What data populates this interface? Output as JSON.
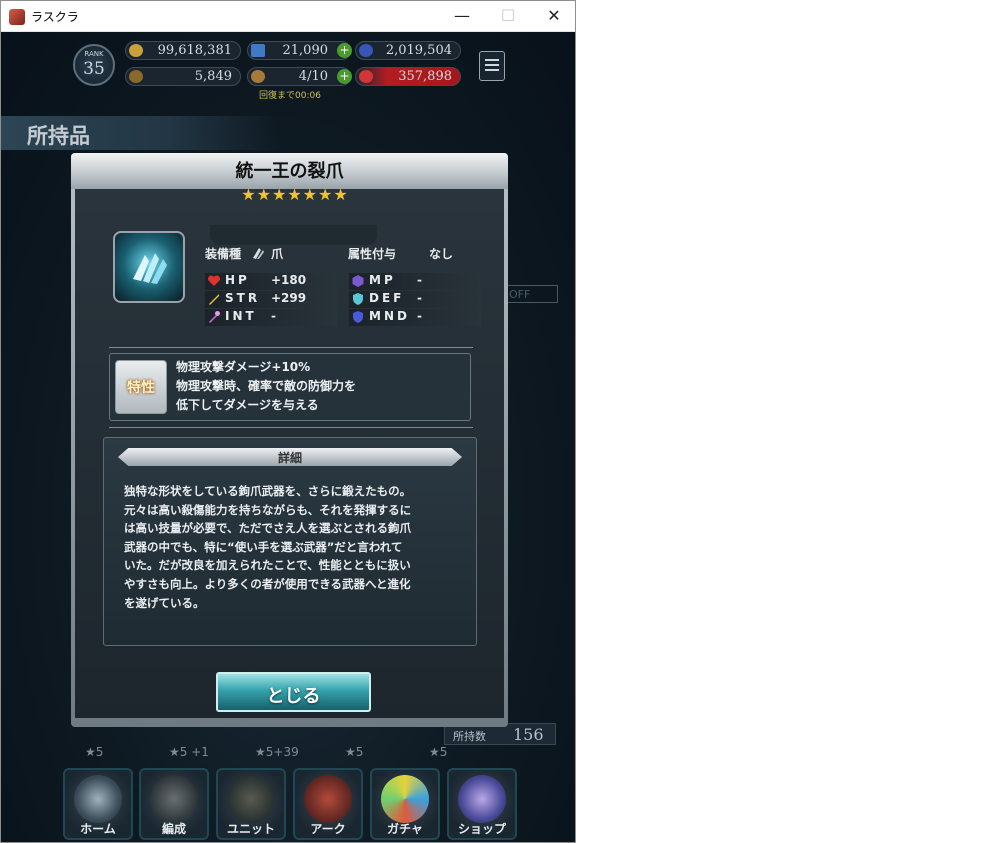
{
  "window": {
    "title": "ラスクラ",
    "min_glyph": "—",
    "max_glyph": "☐",
    "close_glyph": "✕"
  },
  "header": {
    "rank_label": "RANK",
    "rank": "35",
    "gold": "99,618,381",
    "crystals": "21,090",
    "orbs": "2,019,504",
    "trophies": "5,849",
    "stamina": "4/10",
    "red_points": "357,898",
    "recovery_text": "回復まで00:06"
  },
  "page": {
    "section_title": "所持品"
  },
  "background": {
    "filter_off": "OFF",
    "owned_label": "所持数",
    "owned_value": "156",
    "star_labels": [
      "★5",
      "★5 +1",
      "★5+39",
      "★5",
      "★5"
    ]
  },
  "modal": {
    "title": "統一王の裂爪",
    "stars": "★★★★★★★",
    "weapon_type_label": "装備種",
    "weapon_type_value": "爪",
    "element_label": "属性付与",
    "element_value": "なし",
    "stats_left": [
      {
        "name": "HP",
        "value": "+180"
      },
      {
        "name": "STR",
        "value": "+299"
      },
      {
        "name": "INT",
        "value": "-"
      }
    ],
    "stats_right": [
      {
        "name": "MP",
        "value": "-"
      },
      {
        "name": "DEF",
        "value": "-"
      },
      {
        "name": "MND",
        "value": "-"
      }
    ],
    "trait_badge": "特性",
    "trait_lines": [
      "物理攻撃ダメージ+10%",
      "物理攻撃時、確率で敵の防御力を",
      "低下してダメージを与える"
    ],
    "detail_header": "詳細",
    "detail_lines": [
      "独特な形状をしている鉤爪武器を、さらに鍛えたもの。",
      "元々は高い殺傷能力を持ちながらも、それを発揮するに",
      "は高い技量が必要で、ただでさえ人を選ぶとされる鉤爪",
      "武器の中でも、特に“使い手を選ぶ武器”だと言われて",
      "いた。だが改良を加えられたことで、性能とともに扱い",
      "やすさも向上。より多くの者が使用できる武器へと進化",
      "を遂げている。"
    ],
    "close_label": "とじる"
  },
  "nav": {
    "home": "ホーム",
    "formation": "編成",
    "unit": "ユニット",
    "arc": "アーク",
    "gacha": "ガチャ",
    "shop": "ショップ"
  },
  "colors": {
    "accent_cyan": "#36a3ac",
    "star_gold": "#f1c232",
    "hp_red": "#e03030"
  }
}
